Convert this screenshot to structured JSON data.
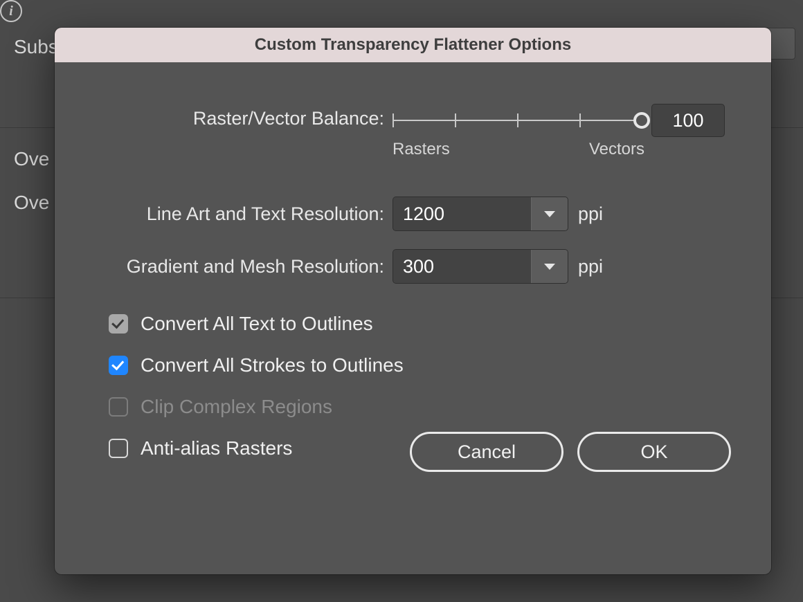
{
  "background": {
    "subs_label": "Subs",
    "ove1_label": "Ove",
    "ove2_label": "Ove"
  },
  "dialog": {
    "title": "Custom Transparency Flattener Options",
    "raster_vector": {
      "label": "Raster/Vector Balance:",
      "min_label": "Rasters",
      "max_label": "Vectors",
      "value": "100"
    },
    "line_art": {
      "label": "Line Art and Text Resolution:",
      "value": "1200",
      "unit": "ppi"
    },
    "gradient": {
      "label": "Gradient and Mesh Resolution:",
      "value": "300",
      "unit": "ppi"
    },
    "checks": {
      "text_outlines": "Convert All Text to Outlines",
      "strokes_outlines": "Convert All Strokes to Outlines",
      "clip_complex": "Clip Complex Regions",
      "anti_alias": "Anti-alias Rasters"
    },
    "buttons": {
      "cancel": "Cancel",
      "ok": "OK"
    }
  }
}
